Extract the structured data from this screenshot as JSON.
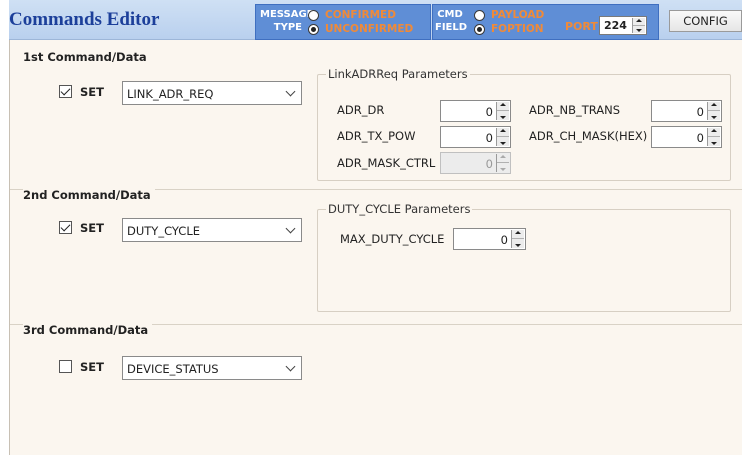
{
  "header": {
    "title": "Commands Editor",
    "message_type_label": [
      "MESSAGE",
      "TYPE"
    ],
    "message_type_options": [
      {
        "label": "CONFIRMED",
        "selected": false
      },
      {
        "label": "UNCONFIRMED",
        "selected": true
      }
    ],
    "cmd_field_label": [
      "CMD",
      "FIELD"
    ],
    "cmd_field_options": [
      {
        "label": "PAYLOAD",
        "selected": false
      },
      {
        "label": "FOPTION",
        "selected": true
      }
    ],
    "port_label": "PORT",
    "port_value": "224",
    "config_button": "CONFIG",
    "colors": {
      "header_bg": "#c4d8f1",
      "box_bg": "#5f8ed6",
      "accent": "#f08a38",
      "title": "#1c3f9a"
    }
  },
  "sections": [
    {
      "title": "1st Command/Data",
      "set_label": "SET",
      "set_checked": true,
      "command": "LINK_ADR_REQ",
      "params_title": "LinkADRReq Parameters",
      "params": [
        {
          "label": "ADR_DR",
          "value": "0",
          "enabled": true
        },
        {
          "label": "ADR_NB_TRANS",
          "value": "0",
          "enabled": true
        },
        {
          "label": "ADR_TX_POW",
          "value": "0",
          "enabled": true
        },
        {
          "label": "ADR_CH_MASK(HEX)",
          "value": "0",
          "enabled": true
        },
        {
          "label": "ADR_MASK_CTRL",
          "value": "0",
          "enabled": false
        }
      ]
    },
    {
      "title": "2nd Command/Data",
      "set_label": "SET",
      "set_checked": true,
      "command": "DUTY_CYCLE",
      "params_title": "DUTY_CYCLE Parameters",
      "params": [
        {
          "label": "MAX_DUTY_CYCLE",
          "value": "0",
          "enabled": true
        }
      ]
    },
    {
      "title": "3rd Command/Data",
      "set_label": "SET",
      "set_checked": false,
      "command": "DEVICE_STATUS"
    }
  ]
}
